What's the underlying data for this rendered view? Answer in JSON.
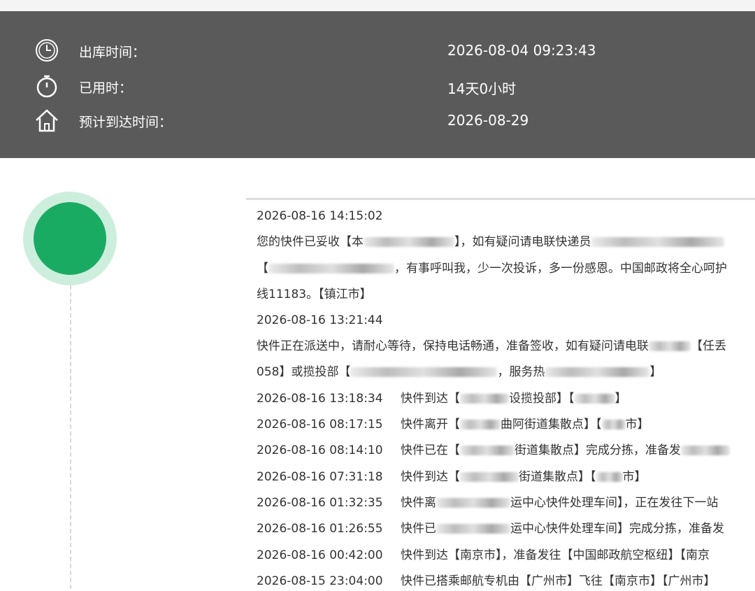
{
  "summary": {
    "rows": [
      {
        "icon": "clock-icon",
        "label": "出库时间：",
        "value": "2026-08-04 09:23:43"
      },
      {
        "icon": "stopwatch-icon",
        "label": "已用时：",
        "value": "14天0小时"
      },
      {
        "icon": "home-icon",
        "label": "预计到达时间：",
        "value": "2026-08-29"
      }
    ]
  },
  "colors": {
    "panel_bg": "#5a5a5a",
    "accent_green": "#1aab62",
    "accent_green_light": "#cdeedd"
  },
  "log": {
    "lines": [
      {
        "kind": "time",
        "text": "2026-08-16 14:15:02"
      },
      {
        "kind": "text",
        "parts": [
          "您的快件已妥收【本",
          "】，如有疑问请电联快递员",
          ""
        ]
      },
      {
        "kind": "text",
        "parts": [
          "【",
          "，有事呼叫我，少一次投诉，多一份感恩。中国邮政将全心呵护"
        ]
      },
      {
        "kind": "text",
        "parts": [
          "线11183。【镇江市】"
        ]
      },
      {
        "kind": "time",
        "text": "2026-08-16 13:21:44"
      },
      {
        "kind": "text",
        "parts": [
          "快件正在派送中，请耐心等待，保持电话畅通，准备签收，如有疑问请电联",
          "【任丢"
        ]
      },
      {
        "kind": "text",
        "parts": [
          "058】或揽投部【",
          "，服务热",
          "】"
        ]
      },
      {
        "kind": "event",
        "time": "2026-08-16 13:18:34",
        "parts": [
          "快件到达【",
          "设揽投部】【",
          "】"
        ]
      },
      {
        "kind": "event",
        "time": "2026-08-16 08:17:15",
        "parts": [
          "快件离开【",
          "曲阿街道集散点】【",
          "市】"
        ]
      },
      {
        "kind": "event",
        "time": "2026-08-16 08:14:10",
        "parts": [
          "快件已在【",
          "街道集散点】完成分拣，准备发",
          ""
        ]
      },
      {
        "kind": "event",
        "time": "2026-08-16 07:31:18",
        "parts": [
          "快件到达【",
          "街道集散点】【",
          "市】"
        ]
      },
      {
        "kind": "event",
        "time": "2026-08-16 01:32:35",
        "parts": [
          "快件离",
          "运中心快件处理车间】，正在发往下一站"
        ]
      },
      {
        "kind": "event",
        "time": "2026-08-16 01:26:55",
        "parts": [
          "快件已",
          "运中心快件处理车间】完成分拣，准备发"
        ]
      },
      {
        "kind": "event",
        "time": "2026-08-16 00:42:00",
        "parts": [
          "快件到达【南京市】，准备发往【中国邮政航空枢纽】【南京"
        ]
      },
      {
        "kind": "event",
        "time": "2026-08-15 23:04:00",
        "parts": [
          "快件已搭乘邮航专机由【广州市】飞往【南京市】【广州市】"
        ]
      }
    ]
  }
}
